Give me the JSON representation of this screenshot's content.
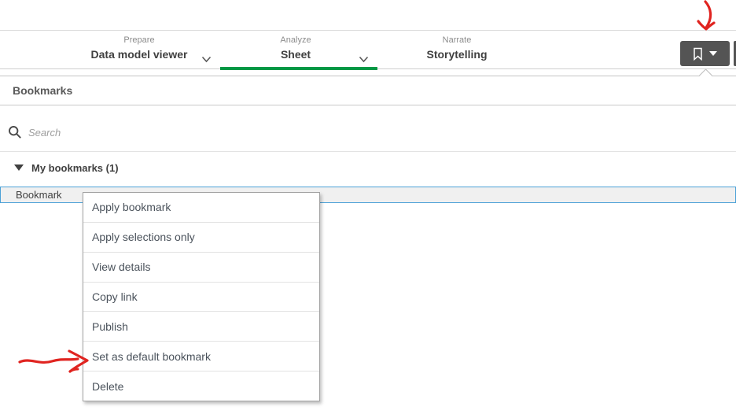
{
  "toolbar": {
    "nav": [
      {
        "section": "Prepare",
        "label": "Data model viewer"
      },
      {
        "section": "Analyze",
        "label": "Sheet"
      },
      {
        "section": "Narrate",
        "label": "Storytelling"
      }
    ],
    "bookmark_button": {
      "icon": "bookmark-icon",
      "caret": "caret-down-icon"
    }
  },
  "panel": {
    "title": "Bookmarks",
    "search_placeholder": "Search",
    "group_label": "My bookmarks (1)",
    "bookmark_item": "Bookmark"
  },
  "context_menu": {
    "items": [
      "Apply bookmark",
      "Apply selections only",
      "View details",
      "Copy link",
      "Publish",
      "Set as default bookmark",
      "Delete"
    ]
  },
  "annotations": {
    "arrow_top": "hand-drawn red arrow pointing down at bookmark button",
    "arrow_menu": "hand-drawn red arrow pointing right at Set as default bookmark"
  },
  "colors": {
    "accent_green": "#009845",
    "selection_border_blue": "#4ba1d7",
    "annotation_red": "#e02420",
    "button_gray": "#545454"
  }
}
